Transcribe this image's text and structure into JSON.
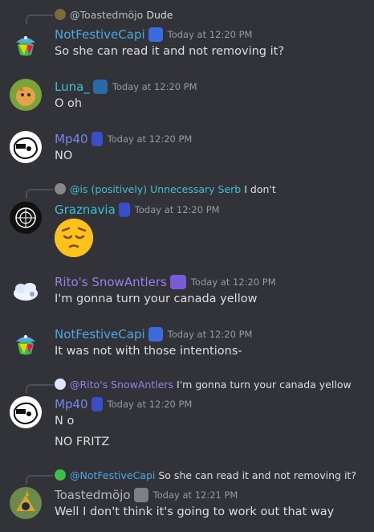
{
  "messages": [
    {
      "reply": {
        "name": "@Toastedmöjo",
        "text": "Dude",
        "name_color": "#b5bac1"
      },
      "author": "NotFestiveCapi",
      "author_color": "#4fa7e2",
      "timestamp": "Today at 12:20 PM",
      "lines": [
        "So she can read it and not removing it?"
      ]
    },
    {
      "author": "Luna_",
      "author_color": "#3ec1d3",
      "timestamp": "Today at 12:20 PM",
      "lines": [
        "O oh"
      ]
    },
    {
      "author": "Mp40",
      "author_color": "#7a86e8",
      "timestamp": "Today at 12:20 PM",
      "lines": [
        "NO"
      ]
    },
    {
      "reply": {
        "name": "@is (positively) Unnecessary Serb",
        "text": "I don't",
        "name_color": "#3ec1d3"
      },
      "author": "Graznavia",
      "author_color": "#3ec1d3",
      "timestamp": "Today at 12:20 PM",
      "emoji": "pensive-face"
    },
    {
      "author": "Rito's SnowAntlers",
      "author_color": "#9a7fe6",
      "timestamp": "Today at 12:20 PM",
      "lines": [
        "I'm gonna turn your canada yellow"
      ]
    },
    {
      "author": "NotFestiveCapi",
      "author_color": "#4fa7e2",
      "timestamp": "Today at 12:20 PM",
      "lines": [
        "It was not with those intentions-"
      ]
    },
    {
      "reply": {
        "name": "@Rito's SnowAntlers",
        "text": "I'm gonna turn your canada yellow",
        "name_color": "#9a7fe6"
      },
      "author": "Mp40",
      "author_color": "#7a86e8",
      "timestamp": "Today at 12:20 PM",
      "lines": [
        "N o",
        "NO FRITZ"
      ]
    },
    {
      "reply": {
        "name": "@NotFestiveCapi",
        "text": "So she can read it and not removing it?",
        "name_color": "#4fa7e2"
      },
      "author": "Toastedmöjo",
      "author_color": "#b5bac1",
      "timestamp": "Today at 12:21 PM",
      "lines": [
        "Well I don't think it's going to work out that way"
      ]
    }
  ]
}
